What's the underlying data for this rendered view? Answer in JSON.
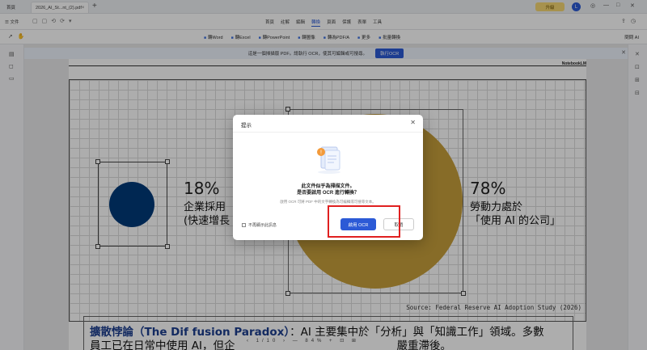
{
  "tabs": {
    "home_label": "首頁",
    "doc_label": "2026_AI_St...nt_(2).pdf",
    "new_tab": "+"
  },
  "header": {
    "upgrade_label": "升級",
    "avatar_letter": "L"
  },
  "menubar": {
    "file_label": "文件",
    "items": [
      "首頁",
      "註解",
      "編輯",
      "轉換",
      "頁面",
      "保護",
      "表單",
      "工具"
    ],
    "active": "轉換"
  },
  "toolbar": {
    "convert_items": [
      "轉Word",
      "轉Excel",
      "轉PowerPoint",
      "轉圖像",
      "轉為PDF/A",
      "更多",
      "批量轉換"
    ],
    "ask_ai": "問問 AI"
  },
  "banner": {
    "text": "這是一個掃描版 PDF。請執行 OCR，使其可編輯或可搜尋。",
    "button": "執行OCR"
  },
  "document": {
    "watermark": "NotebookLM",
    "left_percent": "18%",
    "left_label_line1": "企業採用",
    "left_label_line2": "(快速增長",
    "right_percent": "78%",
    "right_label_line1": "勞動力處於",
    "right_label_line2": "「使用 AI 的公司」",
    "source": "Source: Federal Reserve AI Adoption Study (2026)",
    "para_heading": "擴散悖論（The Dif fusion Paradox）",
    "para_line1_rest": "：AI 主要集中於「分析」與「知識工作」領域。多數",
    "para_line2": "員工已在日常中使用 AI，但企",
    "para_line2_tail": "嚴重滯後。"
  },
  "pagebar": {
    "page": "1/10",
    "zoom": "84%"
  },
  "modal": {
    "title": "提示",
    "main_line1": "此文件似乎為掃描文件。",
    "main_line2": "是否要啟用 OCR 進行轉換？",
    "sub": "啟用 OCR 可將 PDF 中的文字轉換為可編輯或可搜尋文本。",
    "checkbox_label": "不再顯示此訊息",
    "ok_label": "啟用 OCR",
    "cancel_label": "取消"
  },
  "colors": {
    "accent": "#2c5ad6",
    "gold": "#c8a03c",
    "navy": "#003a7a",
    "highlight": "#e02020"
  }
}
